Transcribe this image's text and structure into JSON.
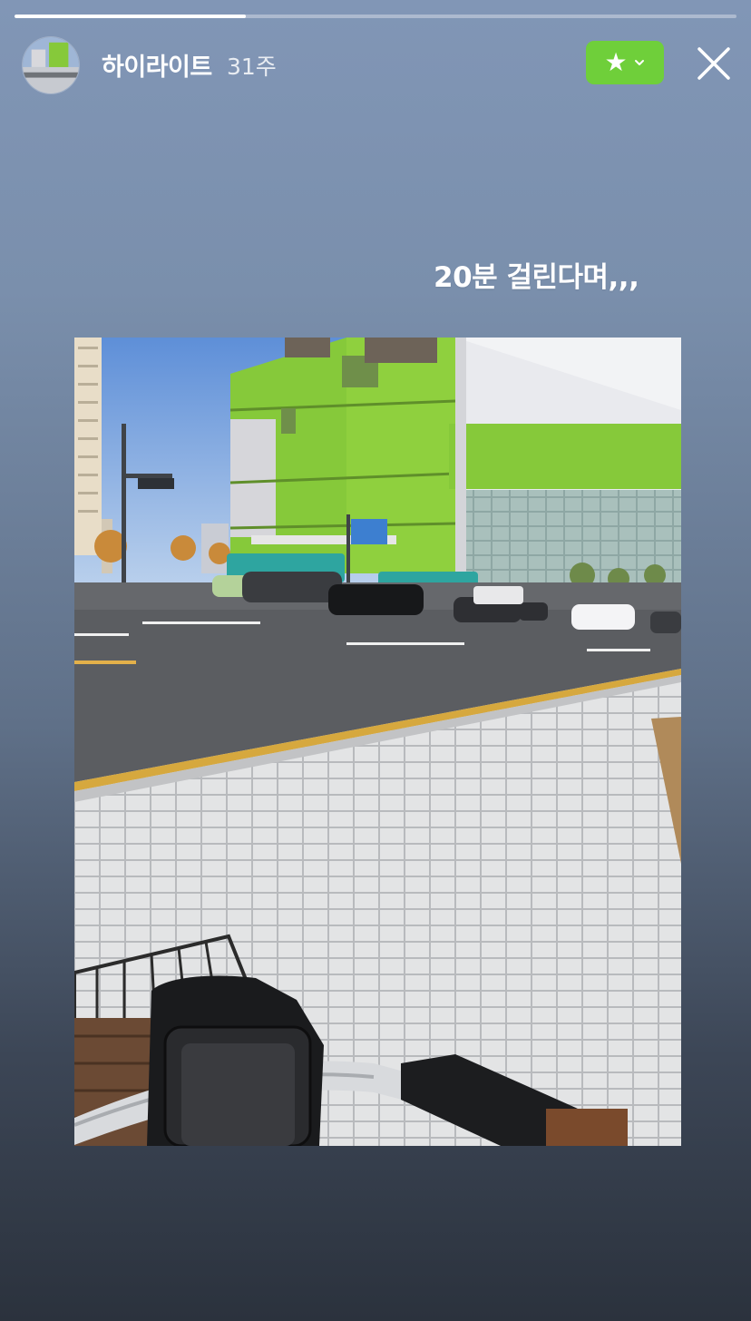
{
  "story": {
    "progress": 0.32,
    "username": "하이라이트",
    "timestamp": "31주",
    "caption": "20분 걸린다며,,,"
  },
  "icons": {
    "close_friends": "star-icon",
    "dropdown": "chevron-down-icon",
    "close": "close-icon"
  },
  "colors": {
    "close_friends_badge": "#6fcf3a",
    "building_green": "#86c93a"
  }
}
